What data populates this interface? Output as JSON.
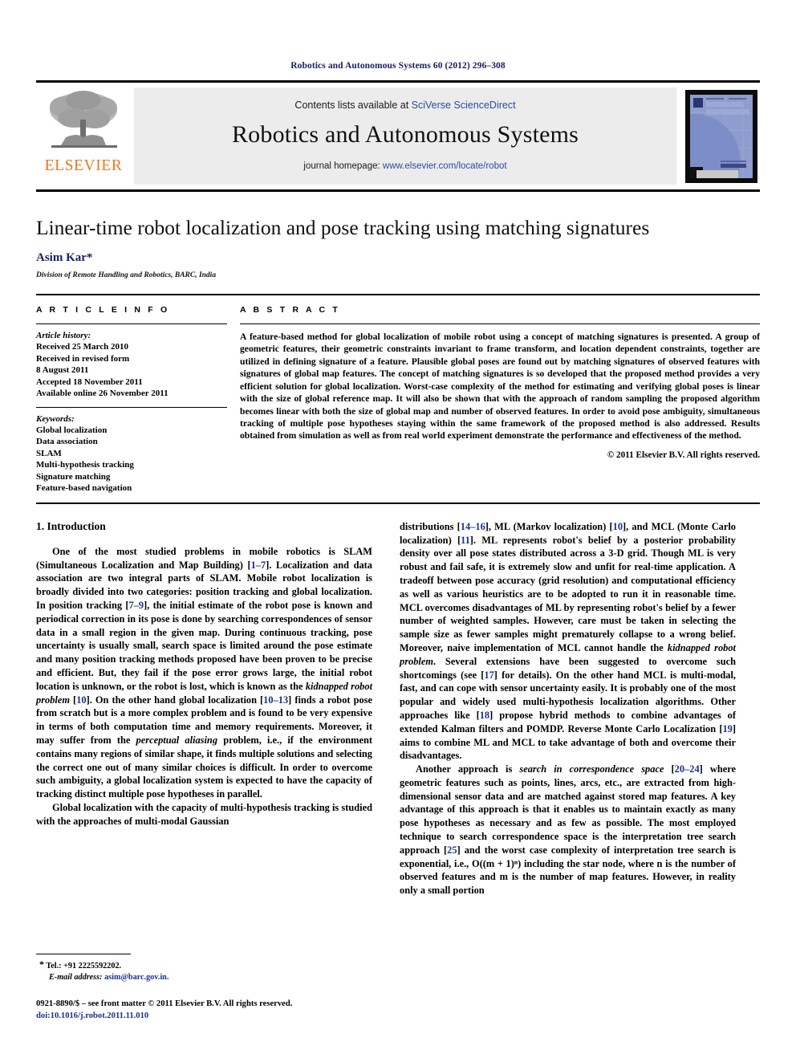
{
  "running_head": "Robotics and Autonomous Systems 60 (2012) 296–308",
  "masthead": {
    "publisher_name": "ELSEVIER",
    "contents_prefix": "Contents lists available at ",
    "contents_link": "SciVerse ScienceDirect",
    "journal_title": "Robotics and Autonomous Systems",
    "homepage_prefix": "journal homepage: ",
    "homepage_link": "www.elsevier.com/locate/robot",
    "cover_title_line1": "Robotics and",
    "cover_title_line2": "Autonomous Systems"
  },
  "article": {
    "title": "Linear-time robot localization and pose tracking using matching signatures",
    "author": "Asim Kar*",
    "affiliation": "Division of Remote Handling and Robotics, BARC, India"
  },
  "article_info": {
    "label": "A R T I C L E   I N F O",
    "history_heading": "Article history:",
    "history": [
      "Received 25 March 2010",
      "Received in revised form",
      "8 August 2011",
      "Accepted 18 November 2011",
      "Available online 26 November 2011"
    ],
    "keywords_heading": "Keywords:",
    "keywords": [
      "Global localization",
      "Data association",
      "SLAM",
      "Multi-hypothesis tracking",
      "Signature matching",
      "Feature-based navigation"
    ]
  },
  "abstract": {
    "label": "A B S T R A C T",
    "text": "A feature-based method for global localization of mobile robot using a concept of matching signatures is presented. A group of geometric features, their geometric constraints invariant to frame transform, and location dependent constraints, together are utilized in defining signature of a feature. Plausible global poses are found out by matching signatures of observed features with signatures of global map features. The concept of matching signatures is so developed that the proposed method provides a very efficient solution for global localization. Worst-case complexity of the method for estimating and verifying global poses is linear with the size of global reference map. It will also be shown that with the approach of random sampling the proposed algorithm becomes linear with both the size of global map and number of observed features. In order to avoid pose ambiguity, simultaneous tracking of multiple pose hypotheses staying within the same framework of the proposed method is also addressed. Results obtained from simulation as well as from real world experiment demonstrate the performance and effectiveness of the method.",
    "copyright": "© 2011 Elsevier B.V. All rights reserved."
  },
  "body": {
    "section_title": "1. Introduction",
    "left_paragraphs": [
      "One of the most studied problems in mobile robotics is SLAM (Simultaneous Localization and Map Building) [1–7]. Localization and data association are two integral parts of SLAM. Mobile robot localization is broadly divided into two categories: position tracking and global localization. In position tracking [7–9], the initial estimate of the robot pose is known and periodical correction in its pose is done by searching correspondences of sensor data in a small region in the given map. During continuous tracking, pose uncertainty is usually small, search space is limited around the pose estimate and many position tracking methods proposed have been proven to be precise and efficient. But, they fail if the pose error grows large, the initial robot location is unknown, or the robot is lost, which is known as the kidnapped robot problem [10]. On the other hand global localization [10–13] finds a robot pose from scratch but is a more complex problem and is found to be very expensive in terms of both computation time and memory requirements. Moreover, it may suffer from the perceptual aliasing problem, i.e., if the environment contains many regions of similar shape, it finds multiple solutions and selecting the correct one out of many similar choices is difficult. In order to overcome such ambiguity, a global localization system is expected to have the capacity of tracking distinct multiple pose hypotheses in parallel.",
      "Global localization with the capacity of multi-hypothesis tracking is studied with the approaches of multi-modal Gaussian"
    ],
    "right_paragraphs": [
      "distributions [14–16], ML (Markov localization) [10], and MCL (Monte Carlo localization) [11]. ML represents robot's belief by a posterior probability density over all pose states distributed across a 3-D grid. Though ML is very robust and fail safe, it is extremely slow and unfit for real-time application. A tradeoff between pose accuracy (grid resolution) and computational efficiency as well as various heuristics are to be adopted to run it in reasonable time. MCL overcomes disadvantages of ML by representing robot's belief by a fewer number of weighted samples. However, care must be taken in selecting the sample size as fewer samples might prematurely collapse to a wrong belief. Moreover, naive implementation of MCL cannot handle the kidnapped robot problem. Several extensions have been suggested to overcome such shortcomings (see [17] for details). On the other hand MCL is multi-modal, fast, and can cope with sensor uncertainty easily. It is probably one of the most popular and widely used multi-hypothesis localization algorithms. Other approaches like [18] propose hybrid methods to combine advantages of extended Kalman filters and POMDP. Reverse Monte Carlo Localization [19] aims to combine ML and MCL to take advantage of both and overcome their disadvantages.",
      "Another approach is search in correspondence space [20–24] where geometric features such as points, lines, arcs, etc., are extracted from high-dimensional sensor data and are matched against stored map features. A key advantage of this approach is that it enables us to maintain exactly as many pose hypotheses as necessary and as few as possible. The most employed technique to search correspondence space is the interpretation tree search approach [25] and the worst case complexity of interpretation tree search is exponential, i.e., O((m + 1)ⁿ) including the star node, where n is the number of observed features and m is the number of map features. However, in reality only a small portion"
    ]
  },
  "footer": {
    "tel_label": "Tel.: +91 2225592202.",
    "email_label": "E-mail address:",
    "email": "asim@barc.gov.in.",
    "issn_line": "0921-8890/$ – see front matter © 2011 Elsevier B.V. All rights reserved.",
    "doi_line": "doi:10.1016/j.robot.2011.11.010"
  },
  "colors": {
    "link_blue": "#2b4b9b",
    "ref_blue": "#1a2f8f",
    "author_blue": "#1a2060",
    "elsevier_orange": "#E87722",
    "band_gray": "#ececec"
  }
}
